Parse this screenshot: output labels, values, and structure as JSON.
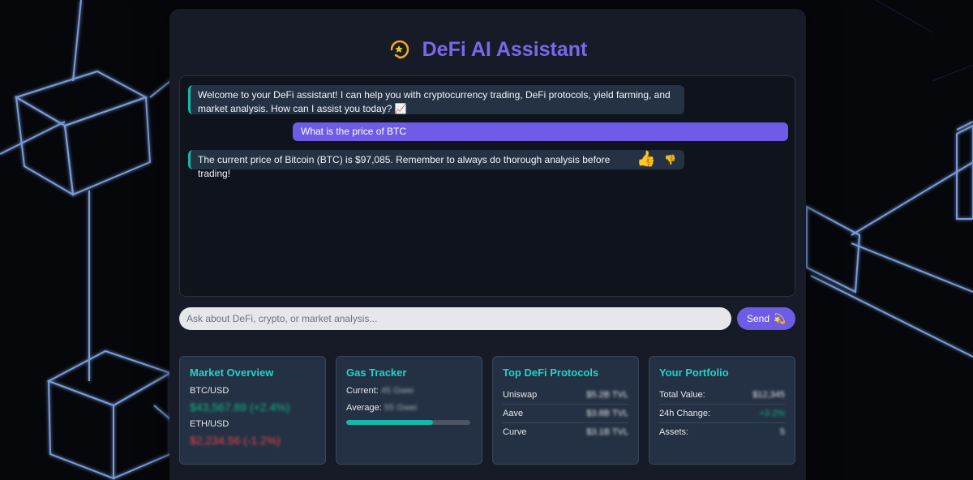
{
  "app": {
    "title": "DeFi AI Assistant",
    "icon": "comet-icon"
  },
  "chat": {
    "messages": [
      {
        "role": "assistant",
        "text": "Welcome to your DeFi assistant! I can help you with cryptocurrency trading, DeFi protocols, yield farming, and market analysis. How can I assist you today? 📈"
      },
      {
        "role": "user",
        "text": "What is the price of BTC"
      },
      {
        "role": "assistant",
        "text": "The current price of Bitcoin (BTC) is $97,085. Remember to always do thorough analysis before trading!"
      }
    ],
    "feedback": {
      "up": "👍",
      "down": "👎"
    }
  },
  "input": {
    "placeholder": "Ask about DeFi, crypto, or market analysis...",
    "value": "",
    "send_label": "Send",
    "send_icon": "💫"
  },
  "market": {
    "title": "Market Overview",
    "btc_label": "BTC/USD",
    "btc_value": "$43,567.89 (+2.4%)",
    "eth_label": "ETH/USD",
    "eth_value": "$2,234.56 (-1.2%)"
  },
  "gas": {
    "title": "Gas Tracker",
    "current_label": "Current:",
    "current_value": "45 Gwei",
    "average_label": "Average:",
    "average_value": "55 Gwei",
    "level": 0.7
  },
  "protocols": {
    "title": "Top DeFi Protocols",
    "items": [
      {
        "name": "Uniswap",
        "value": "$5.2B TVL"
      },
      {
        "name": "Aave",
        "value": "$3.8B TVL"
      },
      {
        "name": "Curve",
        "value": "$3.1B TVL"
      }
    ]
  },
  "portfolio": {
    "title": "Your Portfolio",
    "items": [
      {
        "name": "Total Value:",
        "value": "$12,345"
      },
      {
        "name": "24h Change:",
        "value": "+3.2%"
      },
      {
        "name": "Assets:",
        "value": "5"
      }
    ]
  },
  "colors": {
    "accent": "#6e5ce6",
    "title": "#7b67ea",
    "teal": "#22d3c5",
    "positive": "#10b981",
    "negative": "#ef4444"
  }
}
